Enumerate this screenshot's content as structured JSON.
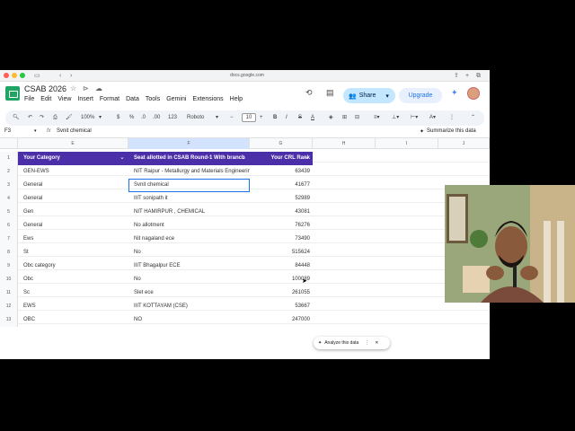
{
  "browser": {
    "url": "docs.google.com"
  },
  "doc": {
    "title": "CSAB 2026"
  },
  "menu": [
    "File",
    "Edit",
    "View",
    "Insert",
    "Format",
    "Data",
    "Tools",
    "Gemini",
    "Extensions",
    "Help"
  ],
  "header_actions": {
    "share": "Share",
    "upgrade": "Upgrade"
  },
  "toolbar": {
    "zoom": "100%",
    "currency": "$",
    "percent": "%",
    "dec_less": ".0",
    "dec_more": ".00",
    "format_123": "123",
    "font": "Roboto",
    "font_size": "10",
    "minus": "−",
    "plus": "+",
    "bold": "B",
    "italic": "I",
    "strike": "S",
    "text_color": "A"
  },
  "formula_bar": {
    "cell_ref": "F3",
    "fx": "fx",
    "value": "Svnit chemical",
    "summarize": "Summarize this data"
  },
  "columns": [
    "E",
    "F",
    "G",
    "H",
    "I",
    "J"
  ],
  "table": {
    "headers": [
      "Your Category",
      "Seat allotted in CSAB Round-1 With branch",
      "Your CRL Rank"
    ],
    "row_numbers": [
      "1",
      "2",
      "3",
      "4",
      "5",
      "6",
      "7",
      "8",
      "9",
      "10",
      "11",
      "12",
      "13"
    ],
    "rows": [
      [
        "GEN-EWS",
        "NIT Raipur - Metallurgy and Materials Engineering",
        "63439"
      ],
      [
        "General",
        "Svnit chemical",
        "41677"
      ],
      [
        "General",
        "IIIT sonipath it",
        "52989"
      ],
      [
        "Gen",
        "NIT HAMIRPUR , CHEMICAL",
        "43081"
      ],
      [
        "General",
        "No allotment",
        "76276"
      ],
      [
        "Ews",
        "Nit nagaland ece",
        "73490"
      ],
      [
        "St",
        "No",
        "515624"
      ],
      [
        "Obc category",
        "IIIT Bhagalpur ECE",
        "84448"
      ],
      [
        "Obc",
        "No",
        "100089"
      ],
      [
        "Sc",
        "Slet ece",
        "261055"
      ],
      [
        "EWS",
        "IIIT KOTTAYAM (CSE)",
        "53667"
      ],
      [
        "OBC",
        "NO",
        "247000"
      ]
    ]
  },
  "analyze": {
    "label": "Analyze this data"
  },
  "colors": {
    "header_bg": "#4a2fa8",
    "share_bg": "#c2e7ff",
    "selection": "#1a73e8"
  }
}
